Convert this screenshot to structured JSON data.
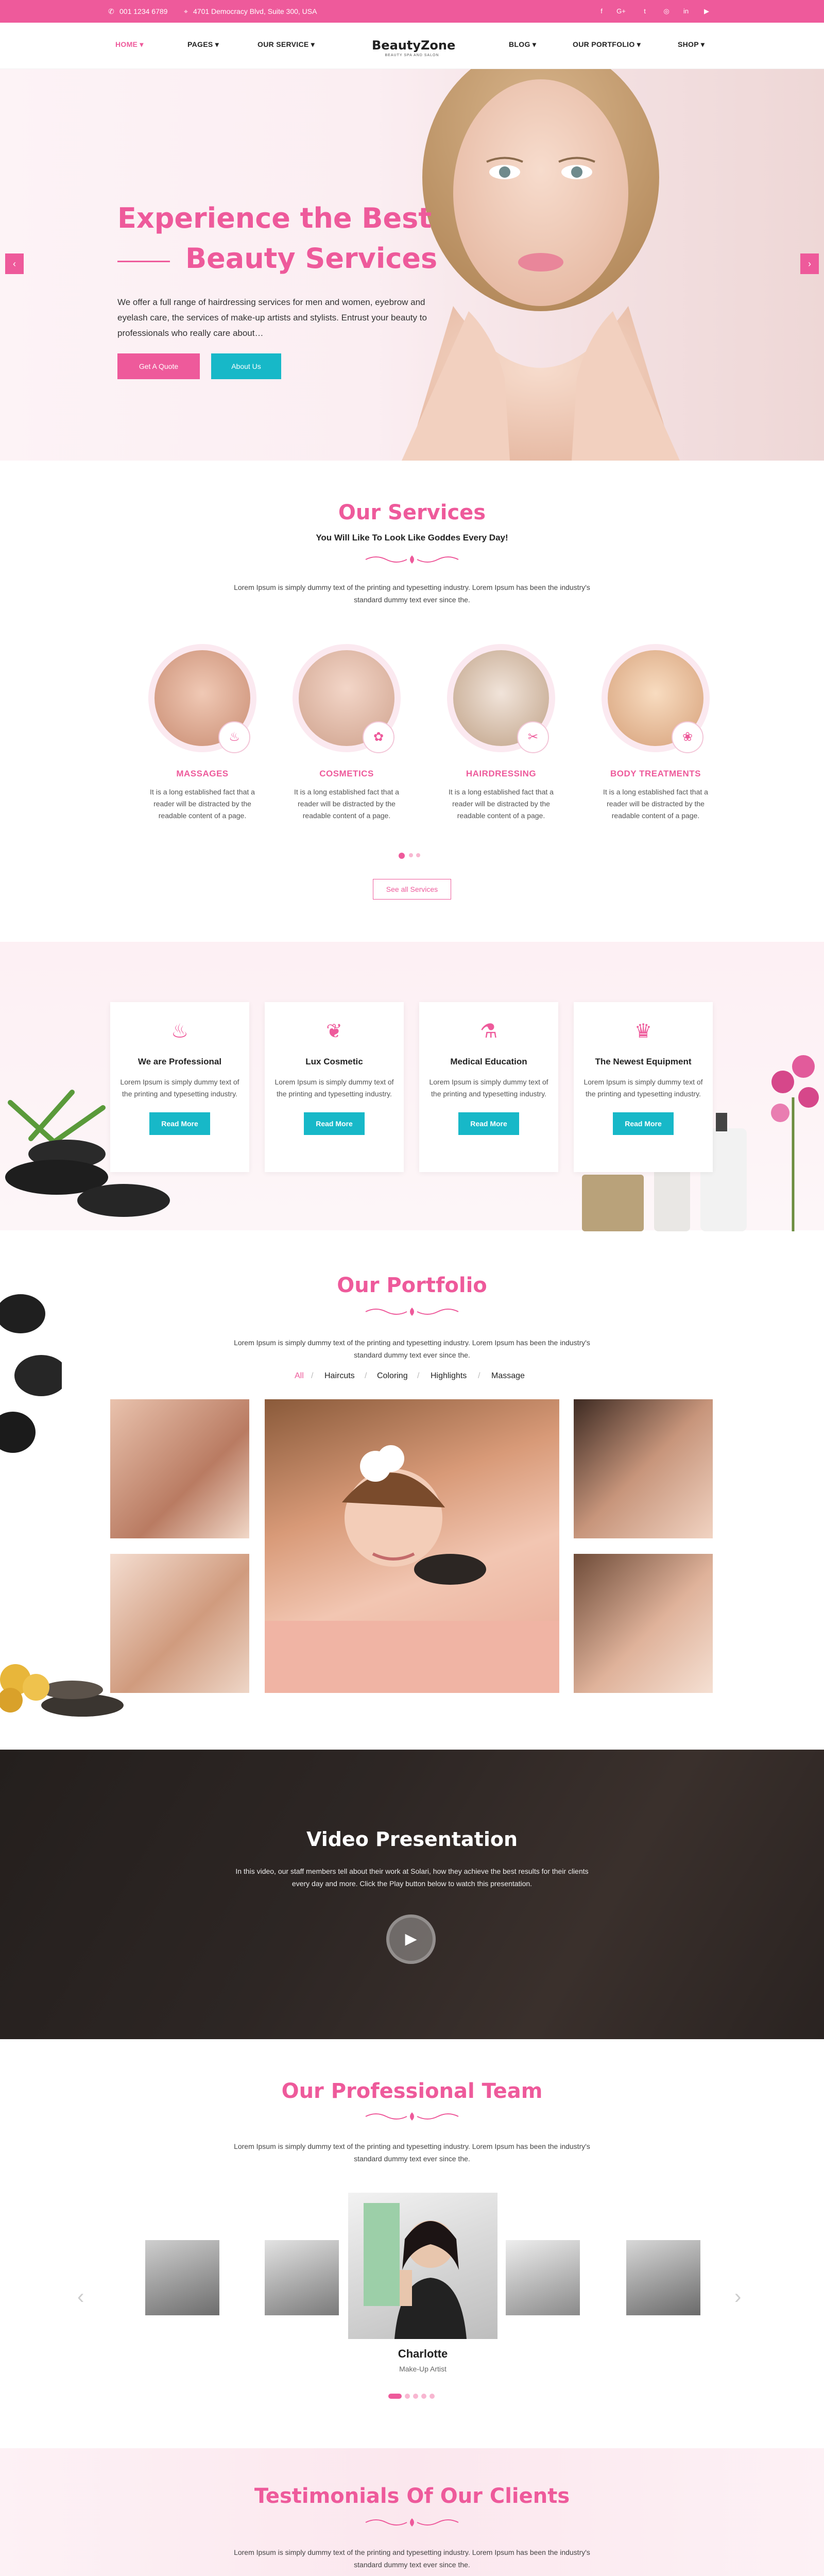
{
  "topbar": {
    "phone": "001 1234 6789",
    "address": "4701 Democracy Blvd, Suite 300, USA",
    "social": [
      "facebook-icon",
      "google-plus-icon",
      "twitter-icon",
      "instagram-icon",
      "linkedin-icon",
      "youtube-icon"
    ],
    "social_glyphs": [
      "f",
      "G+",
      "t",
      "◎",
      "in",
      "▶"
    ]
  },
  "nav": {
    "items": [
      "HOME",
      "PAGES",
      "OUR SERVICE",
      "BLOG",
      "OUR PORTFOLIO",
      "SHOP"
    ],
    "caret": "▾",
    "logo_title": "BeautyZone",
    "logo_sub": "BEAUTY SPA AND SALON"
  },
  "hero": {
    "title_1": "Experience the Best",
    "title_2": "Beauty Services",
    "text": "We offer a full range of hairdressing services for men and women, eyebrow and eyelash care, the services of make-up artists and stylists. Entrust your beauty to professionals who really care about…",
    "btn_quote": "Get A Quote",
    "btn_about": "About Us",
    "prev": "‹",
    "next": "›"
  },
  "services": {
    "title": "Our Services",
    "subtitle": "You Will Like To Look Like Goddes Every Day!",
    "text": "Lorem Ipsum is simply dummy text of the printing and typesetting industry. Lorem Ipsum has been the industry's standard dummy text ever since the.",
    "items": [
      {
        "name": "MASSAGES",
        "desc": "It is a long established fact that a reader will be distracted by the readable content of a page.",
        "glyph": "♨"
      },
      {
        "name": "COSMETICS",
        "desc": "It is a long established fact that a reader will be distracted by the readable content of a page.",
        "glyph": "✿"
      },
      {
        "name": "HAIRDRESSING",
        "desc": "It is a long established fact that a reader will be distracted by the readable content of a page.",
        "glyph": "✂"
      },
      {
        "name": "BODY TREATMENTS",
        "desc": "It is a long established fact that a reader will be distracted by the readable content of a page.",
        "glyph": "❀"
      }
    ],
    "see_all": "See all Services"
  },
  "features": [
    {
      "title": "We are Professional",
      "text": "Lorem Ipsum is simply dummy text of the printing and typesetting industry.",
      "btn": "Read More",
      "glyph": "♨"
    },
    {
      "title": "Lux Cosmetic",
      "text": "Lorem Ipsum is simply dummy text of the printing and typesetting industry.",
      "btn": "Read More",
      "glyph": "❦"
    },
    {
      "title": "Medical Education",
      "text": "Lorem Ipsum is simply dummy text of the printing and typesetting industry.",
      "btn": "Read More",
      "glyph": "⚗"
    },
    {
      "title": "The Newest Equipment",
      "text": "Lorem Ipsum is simply dummy text of the printing and typesetting industry.",
      "btn": "Read More",
      "glyph": "♛"
    }
  ],
  "portfolio": {
    "title": "Our Portfolio",
    "text": "Lorem Ipsum is simply dummy text of the printing and typesetting industry. Lorem Ipsum has been the industry's standard dummy text ever since the.",
    "filters": [
      "All",
      "Haircuts",
      "Coloring",
      "Highlights",
      "Massage"
    ],
    "separator": "/"
  },
  "video": {
    "title": "Video Presentation",
    "text": "In this video, our staff members tell about their work at Solari, how they achieve the best results for their clients every day and more. Click the Play button below to watch this presentation.",
    "play": "▶"
  },
  "team": {
    "title": "Our Professional Team",
    "text": "Lorem Ipsum is simply dummy text of the printing and typesetting industry. Lorem Ipsum has been the industry's standard dummy text ever since the.",
    "member_name": "Charlotte",
    "member_role": "Make-Up Artist",
    "prev": "‹",
    "next": "›"
  },
  "testimonials": {
    "title": "Testimonials Of Our Clients",
    "text": "Lorem Ipsum is simply dummy text of the printing and typesetting industry. Lorem Ipsum has been the industry's standard dummy text ever since the."
  },
  "colors": {
    "accent": "#ee5a9b",
    "teal": "#17b8c8",
    "dark": "#2b2523"
  }
}
